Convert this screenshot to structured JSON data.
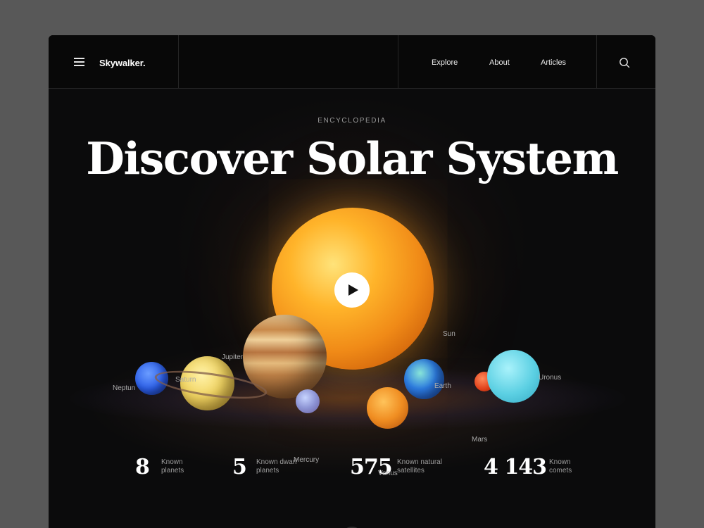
{
  "header": {
    "logo": "Skywalker.",
    "menu_icon": "hamburger-icon",
    "nav": [
      "Explore",
      "About",
      "Articles"
    ],
    "search_icon": "search-icon"
  },
  "hero": {
    "eyebrow": "ENCYCLOPEDIA",
    "title": "Discover Solar System",
    "play_icon": "play-icon"
  },
  "bodies": {
    "sun": "Sun",
    "jupiter": "Jupiter",
    "saturn": "Saturn",
    "neptune": "Neptun",
    "mercury": "Mercury",
    "venus": "Venus",
    "earth": "Earth",
    "mars": "Mars",
    "uranus": "Uronus"
  },
  "stats": [
    {
      "value": "8",
      "label": "Known planets"
    },
    {
      "value": "5",
      "label": "Known dwarf planets"
    },
    {
      "value": "575",
      "label": "Known natural satellites"
    },
    {
      "value": "4 143",
      "label": "Known comets"
    }
  ],
  "scroll_icon": "arrow-down-icon",
  "colors": {
    "background": "#0b0b0c",
    "page": "#585858",
    "sun": "#f5a623"
  }
}
